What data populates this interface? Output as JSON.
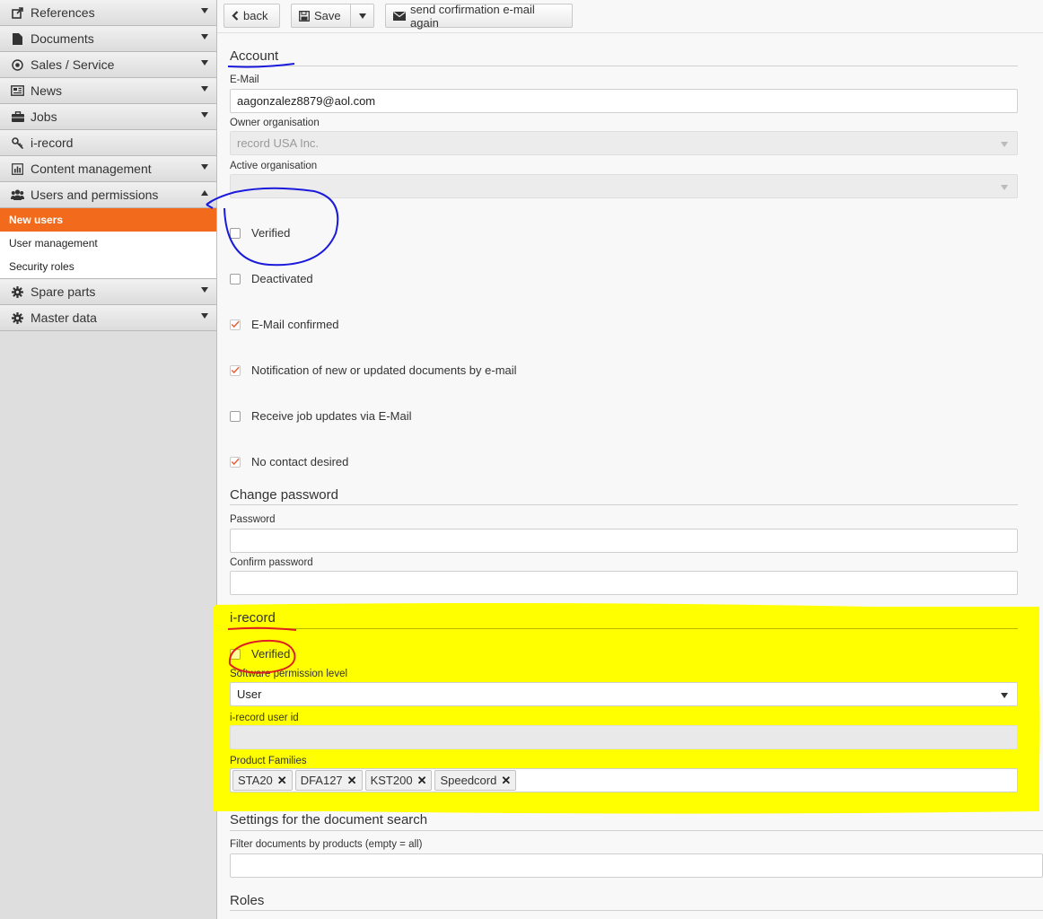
{
  "sidebar": {
    "items": [
      {
        "label": "References",
        "icon": "external-link-icon"
      },
      {
        "label": "Documents",
        "icon": "file-icon"
      },
      {
        "label": "Sales / Service",
        "icon": "target-icon"
      },
      {
        "label": "News",
        "icon": "newspaper-icon"
      },
      {
        "label": "Jobs",
        "icon": "briefcase-icon"
      },
      {
        "label": "i-record",
        "icon": "key-icon"
      },
      {
        "label": "Content management",
        "icon": "chart-icon"
      },
      {
        "label": "Users and permissions",
        "icon": "users-icon"
      },
      {
        "label": "Spare parts",
        "icon": "gear-icon"
      },
      {
        "label": "Master data",
        "icon": "gear-icon"
      }
    ],
    "subitems": [
      {
        "label": "New users",
        "active": true
      },
      {
        "label": "User management"
      },
      {
        "label": "Security roles"
      }
    ]
  },
  "toolbar": {
    "back_label": "back",
    "save_label": "Save",
    "send_label": "send corfirmation e-mail again"
  },
  "account": {
    "title": "Account",
    "email_label": "E-Mail",
    "email_value": "aagonzalez8879@aol.com",
    "owner_org_label": "Owner organisation",
    "owner_org_value": "record USA Inc.",
    "active_org_label": "Active organisation",
    "active_org_value": "",
    "checkboxes": [
      {
        "label": "Verified",
        "checked": false
      },
      {
        "label": "Deactivated",
        "checked": false
      },
      {
        "label": "E-Mail confirmed",
        "checked": true
      },
      {
        "label": "Notification of new or updated documents by e-mail",
        "checked": true
      },
      {
        "label": "Receive job updates via E-Mail",
        "checked": false
      },
      {
        "label": "No contact desired",
        "checked": true
      }
    ]
  },
  "change_password": {
    "title": "Change password",
    "password_label": "Password",
    "confirm_label": "Confirm password"
  },
  "irecord": {
    "title": "i-record",
    "verified_label": "Verified",
    "permission_label": "Software permission level",
    "permission_value": "User",
    "user_id_label": "i-record user id",
    "user_id_value": "",
    "families_label": "Product Families",
    "families": [
      "STA20",
      "DFA127",
      "KST200",
      "Speedcord"
    ]
  },
  "doc_search": {
    "title": "Settings for the document search",
    "filter_label": "Filter documents by products (empty = all)"
  },
  "roles": {
    "title": "Roles"
  },
  "colors": {
    "accent": "#f26b1d",
    "highlight": "#ffff00",
    "annotation_blue": "#1a1adc",
    "annotation_red": "#e02020",
    "check": "#e8603a"
  }
}
